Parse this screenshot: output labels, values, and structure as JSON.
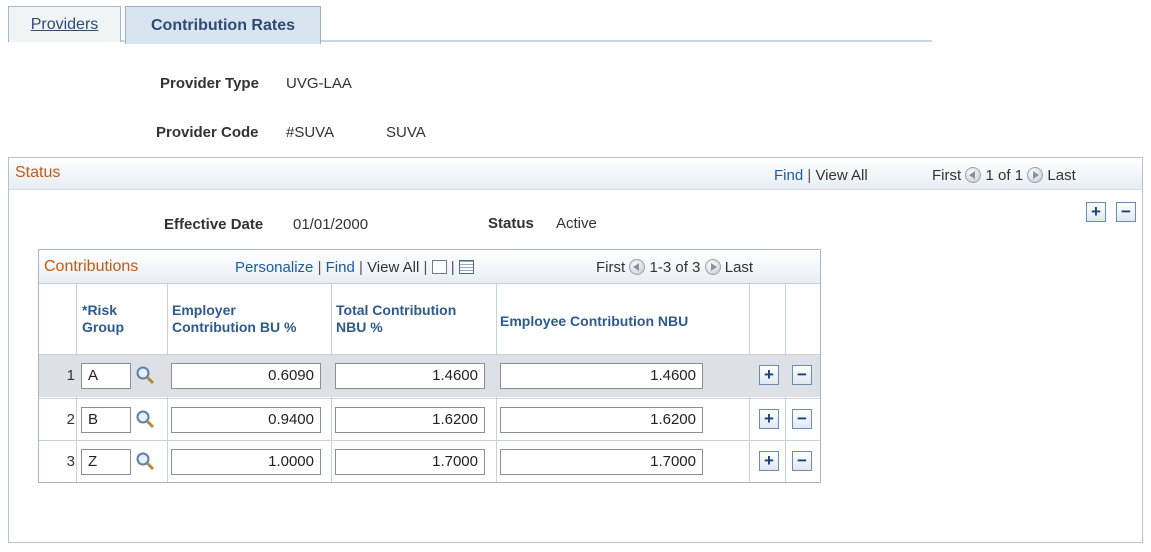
{
  "tabs": [
    {
      "label": "Providers",
      "active": false
    },
    {
      "label": "Contribution Rates",
      "active": true
    }
  ],
  "provider": {
    "type_label": "Provider Type",
    "type_value": "UVG-LAA",
    "code_label": "Provider Code",
    "code_value": "#SUVA",
    "code_desc": "SUVA"
  },
  "status_section": {
    "title": "Status",
    "find": "Find",
    "view_all": "View All",
    "first": "First",
    "count": "1 of 1",
    "last": "Last",
    "effective_date_label": "Effective Date",
    "effective_date_value": "01/01/2000",
    "status_label": "Status",
    "status_value": "Active"
  },
  "contributions": {
    "title": "Contributions",
    "personalize": "Personalize",
    "find": "Find",
    "view_all": "View All",
    "first": "First",
    "count": "1-3 of 3",
    "last": "Last",
    "columns": {
      "risk_group_line1": "*Risk",
      "risk_group_line2": "Group",
      "employer_line1": "Employer",
      "employer_line2": "Contribution BU %",
      "total_line1": "Total Contribution",
      "total_line2": "NBU %",
      "employee": "Employee Contribution NBU"
    },
    "rows": [
      {
        "num": "1",
        "risk_group": "A",
        "employer": "0.6090",
        "total": "1.4600",
        "employee": "1.4600"
      },
      {
        "num": "2",
        "risk_group": "B",
        "employer": "0.9400",
        "total": "1.6200",
        "employee": "1.6200"
      },
      {
        "num": "3",
        "risk_group": "Z",
        "employer": "1.0000",
        "total": "1.7000",
        "employee": "1.7000"
      }
    ]
  },
  "icons": {
    "lookup": "magnifier-icon",
    "add": "plus-icon",
    "delete": "minus-icon",
    "zoom": "new-window-icon",
    "download": "grid-icon"
  },
  "colors": {
    "section_title": "#c55a11",
    "link": "#1f5aa5",
    "header_text": "#2d5a8f",
    "row_highlight": "#dde1e6"
  }
}
